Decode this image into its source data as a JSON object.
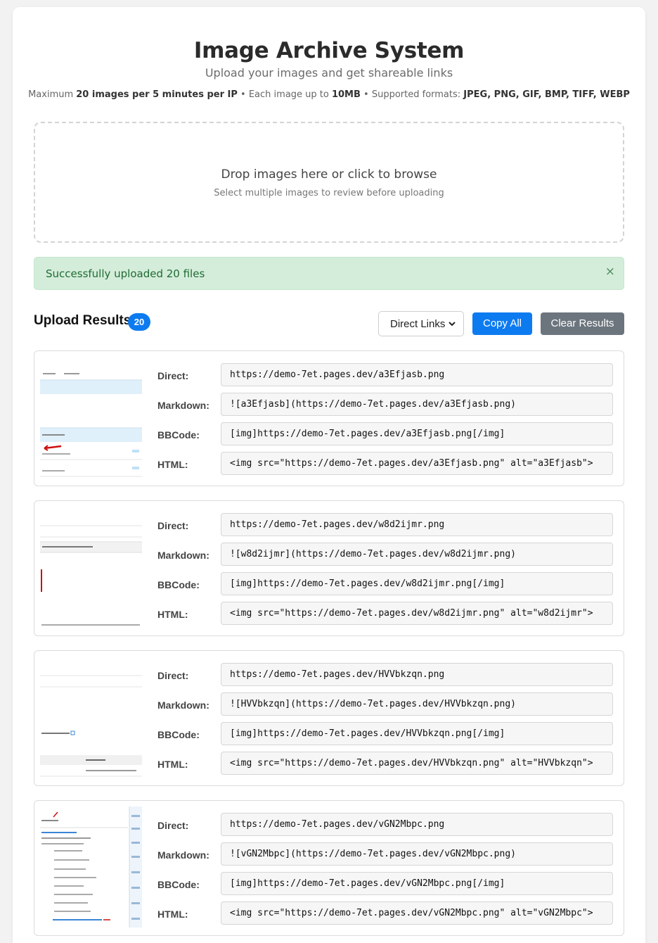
{
  "header": {
    "title": "Image Archive System",
    "subtitle": "Upload your images and get shareable links",
    "limits": {
      "prefix": "Maximum ",
      "count": "20 images per 5 minutes per IP",
      "sep1": " • Each image up to ",
      "size": "10MB",
      "sep2": " • Supported formats: ",
      "formats": "JPEG, PNG, GIF, BMP, TIFF, WEBP"
    }
  },
  "dropzone": {
    "main": "Drop images here or click to browse",
    "sub": "Select multiple images to review before uploading"
  },
  "alert": {
    "text": "Successfully uploaded 20 files",
    "close": "×"
  },
  "results_header": {
    "title": "Upload Results",
    "count": "20",
    "format_selected": "Direct Links",
    "copy_all": "Copy All",
    "clear": "Clear Results"
  },
  "labels": {
    "direct": "Direct:",
    "markdown": "Markdown:",
    "bbcode": "BBCode:",
    "html": "HTML:"
  },
  "results": [
    {
      "direct": "https://demo-7et.pages.dev/a3Efjasb.png",
      "markdown": "![a3Efjasb](https://demo-7et.pages.dev/a3Efjasb.png)",
      "bbcode": "[img]https://demo-7et.pages.dev/a3Efjasb.png[/img]",
      "html": "<img src=\"https://demo-7et.pages.dev/a3Efjasb.png\" alt=\"a3Efjasb\">"
    },
    {
      "direct": "https://demo-7et.pages.dev/w8d2ijmr.png",
      "markdown": "![w8d2ijmr](https://demo-7et.pages.dev/w8d2ijmr.png)",
      "bbcode": "[img]https://demo-7et.pages.dev/w8d2ijmr.png[/img]",
      "html": "<img src=\"https://demo-7et.pages.dev/w8d2ijmr.png\" alt=\"w8d2ijmr\">"
    },
    {
      "direct": "https://demo-7et.pages.dev/HVVbkzqn.png",
      "markdown": "![HVVbkzqn](https://demo-7et.pages.dev/HVVbkzqn.png)",
      "bbcode": "[img]https://demo-7et.pages.dev/HVVbkzqn.png[/img]",
      "html": "<img src=\"https://demo-7et.pages.dev/HVVbkzqn.png\" alt=\"HVVbkzqn\">"
    },
    {
      "direct": "https://demo-7et.pages.dev/vGN2Mbpc.png",
      "markdown": "![vGN2Mbpc](https://demo-7et.pages.dev/vGN2Mbpc.png)",
      "bbcode": "[img]https://demo-7et.pages.dev/vGN2Mbpc.png[/img]",
      "html": "<img src=\"https://demo-7et.pages.dev/vGN2Mbpc.png\" alt=\"vGN2Mbpc\">"
    }
  ]
}
